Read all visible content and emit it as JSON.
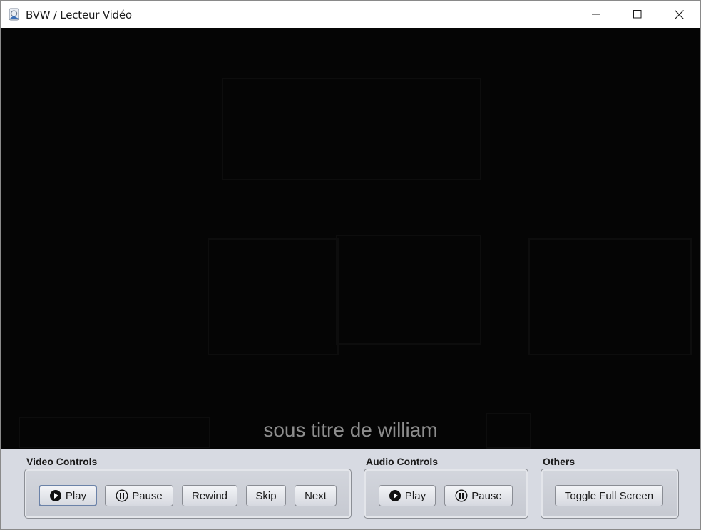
{
  "window": {
    "title": "BVW / Lecteur Vidéo",
    "controls": [
      "minimize-icon",
      "maximize-icon",
      "close-icon"
    ]
  },
  "video": {
    "subtitle": "sous titre de william"
  },
  "video_controls": {
    "title": "Video Controls",
    "play": "Play",
    "pause": "Pause",
    "rewind": "Rewind",
    "skip": "Skip",
    "next": "Next"
  },
  "audio_controls": {
    "title": "Audio Controls",
    "play": "Play",
    "pause": "Pause"
  },
  "others": {
    "title": "Others",
    "fullscreen": "Toggle Full Screen"
  },
  "colors": {
    "video_bg": "#050505",
    "controls_bg": "#d7dae2",
    "subtitle": "#8d8d8d"
  }
}
